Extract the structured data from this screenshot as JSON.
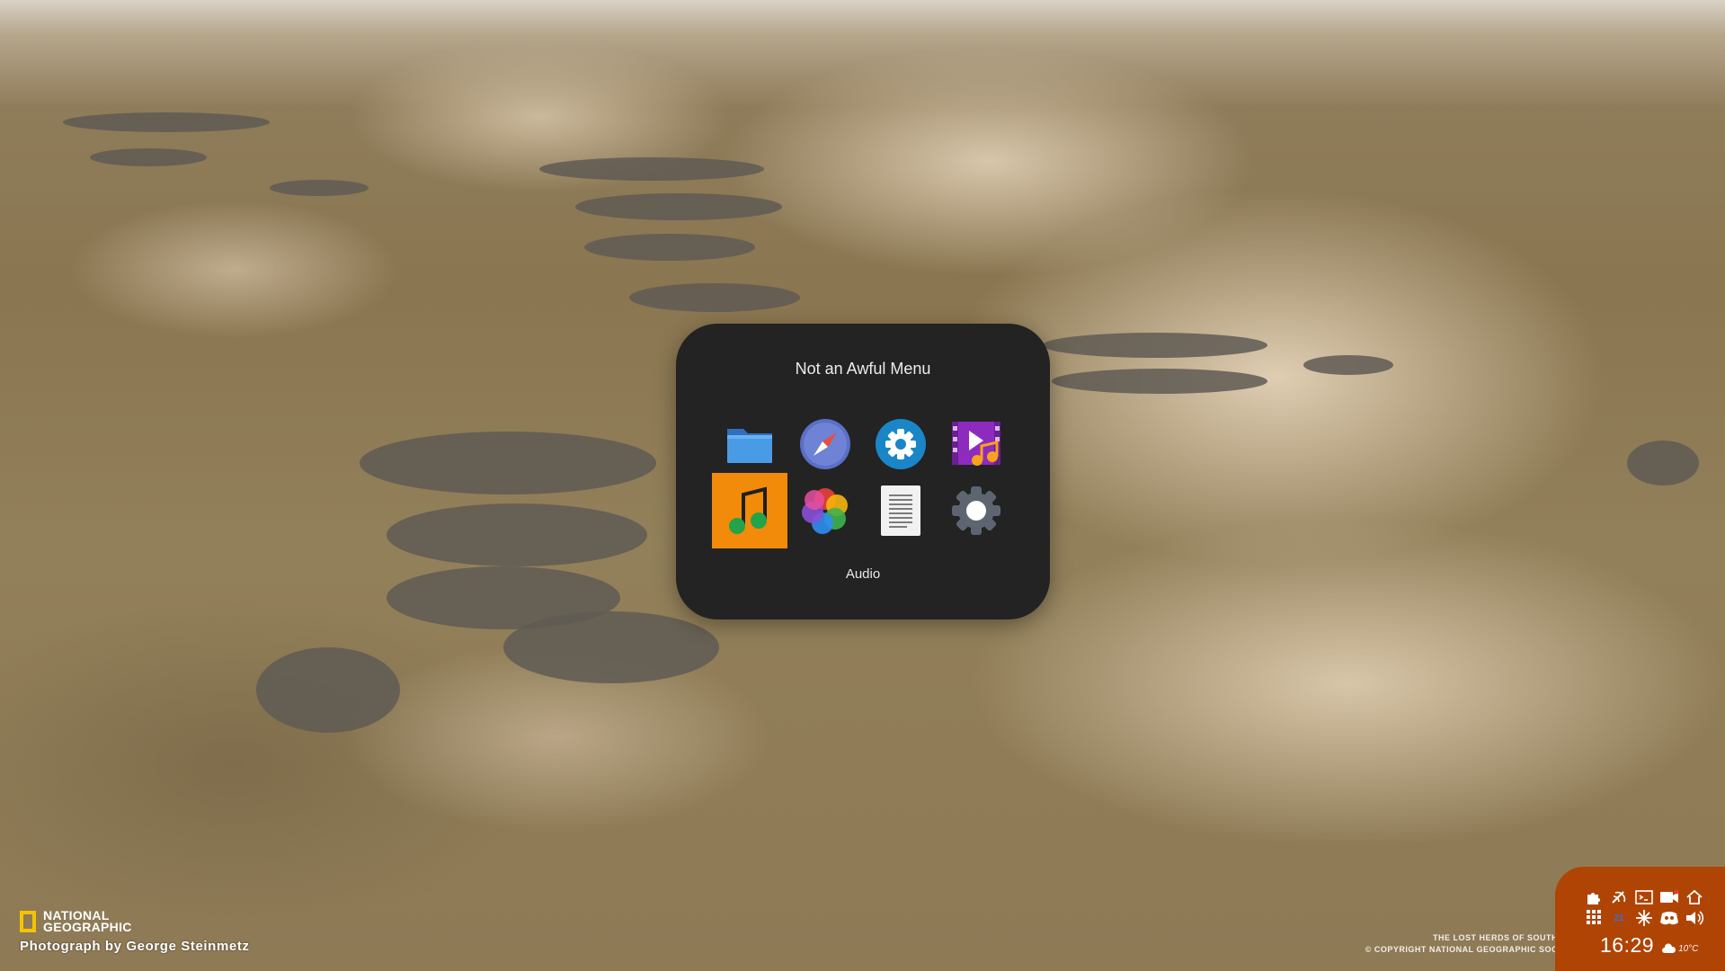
{
  "wallpaper": {
    "brand": "NATIONAL GEOGRAPHIC",
    "brand_line1": "NATIONAL",
    "brand_line2": "GEOGRAPHIC",
    "credit": "Photograph by George Steinmetz",
    "caption_line1": "THE LOST HERDS OF SOUTH",
    "caption_line2": "© COPYRIGHT NATIONAL GEOGRAPHIC SOC"
  },
  "menu": {
    "title": "Not an Awful Menu",
    "selected_label": "Audio",
    "apps": [
      {
        "icon": "folder-icon",
        "selected": false
      },
      {
        "icon": "compass-icon",
        "selected": false
      },
      {
        "icon": "settings-gear-icon",
        "selected": false
      },
      {
        "icon": "video-icon",
        "selected": false
      },
      {
        "icon": "music-note-icon",
        "selected": true
      },
      {
        "icon": "photos-icon",
        "selected": false
      },
      {
        "icon": "text-document-icon",
        "selected": false
      },
      {
        "icon": "system-gear-icon",
        "selected": false
      }
    ],
    "accent_color": "#f28a0a",
    "background_color": "#232323"
  },
  "panel": {
    "background_color": "#b04405",
    "clock": "16:29",
    "temperature": "10°C",
    "workspace_number": "21",
    "tray_icons_row1": [
      "puzzle-icon",
      "satellite-icon",
      "terminal-icon",
      "camera-icon",
      "home-icon"
    ],
    "tray_icons_row2": [
      "apps-grid-icon",
      "workspace-indicator",
      "snowflake-icon",
      "discord-icon",
      "volume-icon"
    ]
  }
}
